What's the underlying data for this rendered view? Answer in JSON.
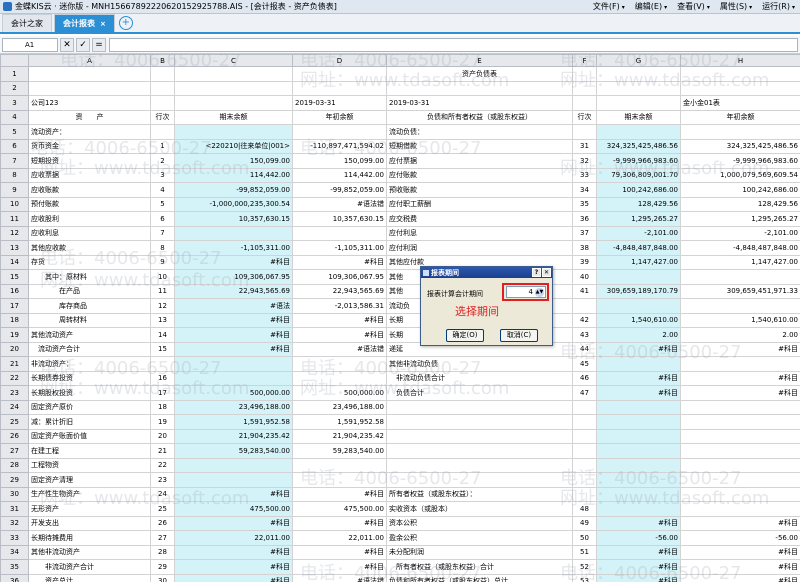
{
  "window": {
    "title": "金蝶KIS云 · 迷你版 - MNH15667892220620152925788.AIS - [会计报表 - 资产负债表]",
    "menus": [
      "文件(F)",
      "编辑(E)",
      "查看(V)",
      "属性(S)",
      "运行(R)"
    ]
  },
  "tabs": [
    {
      "label": "会计之家"
    },
    {
      "label": "会计报表",
      "close": "×"
    }
  ],
  "tab_add": "+",
  "formula": {
    "cell_ref": "A1",
    "cancel": "✕",
    "confirm": "✓",
    "fx": "="
  },
  "watermarks": [
    "电话：4006-6500-27",
    "网址：www.tdasoft.com"
  ],
  "columns": [
    "A",
    "B",
    "C",
    "D",
    "E",
    "F",
    "G",
    "H"
  ],
  "rows": [
    {
      "n": "1",
      "a": "",
      "b": "",
      "c": "",
      "d": "",
      "e": "资产负债表",
      "f": "",
      "g": "",
      "h": ""
    },
    {
      "n": "2",
      "a": "",
      "b": "",
      "c": "",
      "d": "",
      "e": "",
      "f": "",
      "g": "",
      "h": ""
    },
    {
      "n": "3",
      "a": "公司123",
      "b": "",
      "c": "",
      "d": "2019-03-31",
      "e": "2019-03-31",
      "f": "",
      "g": "",
      "h": "金小金01表"
    },
    {
      "n": "4",
      "a": "资　　产",
      "b": "行次",
      "c": "期末余额",
      "d": "年初余额",
      "e": "负债和所有者权益（或股东权益）",
      "f": "行次",
      "g": "期末余额",
      "h": "年初余额"
    },
    {
      "n": "5",
      "a": "流动资产：",
      "b": "",
      "c": "",
      "d": "",
      "e": "流动负债：",
      "f": "",
      "g": "",
      "h": ""
    },
    {
      "n": "6",
      "a": "货币资金",
      "b": "1",
      "c": "<220210|往来单位|001>",
      "d": "-110,897,471,594.02",
      "e": "短期借款",
      "f": "31",
      "g": "324,325,425,486.56",
      "h": "324,325,425,486.56"
    },
    {
      "n": "7",
      "a": "短期投资",
      "b": "2",
      "c": "150,099.00",
      "d": "150,099.00",
      "e": "应付票据",
      "f": "32",
      "g": "-9,999,966,983.60",
      "h": "-9,999,966,983.60"
    },
    {
      "n": "8",
      "a": "应收票据",
      "b": "3",
      "c": "114,442.00",
      "d": "114,442.00",
      "e": "应付账款",
      "f": "33",
      "g": "79,306,809,001.70",
      "h": "1,000,079,569,609.54"
    },
    {
      "n": "9",
      "a": "应收账款",
      "b": "4",
      "c": "-99,852,059.00",
      "d": "-99,852,059.00",
      "e": "预收账款",
      "f": "34",
      "g": "100,242,686.00",
      "h": "100,242,686.00"
    },
    {
      "n": "10",
      "a": "预付账款",
      "b": "5",
      "c": "-1,000,000,235,300.54",
      "d": "#语法错",
      "e": "应付职工薪酬",
      "f": "35",
      "g": "128,429.56",
      "h": "128,429.56"
    },
    {
      "n": "11",
      "a": "应收股利",
      "b": "6",
      "c": "10,357,630.15",
      "d": "10,357,630.15",
      "e": "应交税费",
      "f": "36",
      "g": "1,295,265.27",
      "h": "1,295,265.27"
    },
    {
      "n": "12",
      "a": "应收利息",
      "b": "7",
      "c": "",
      "d": "",
      "e": "应付利息",
      "f": "37",
      "g": "-2,101.00",
      "h": "-2,101.00"
    },
    {
      "n": "13",
      "a": "其他应收款",
      "b": "8",
      "c": "-1,105,311.00",
      "d": "-1,105,311.00",
      "e": "应付利润",
      "f": "38",
      "g": "-4,848,487,848.00",
      "h": "-4,848,487,848.00"
    },
    {
      "n": "14",
      "a": "存货",
      "b": "9",
      "c": "#科目",
      "d": "#科目",
      "e": "其他应付款",
      "f": "39",
      "g": "1,147,427.00",
      "h": "1,147,427.00"
    },
    {
      "n": "15",
      "a": "　　其中：原材料",
      "b": "10",
      "c": "109,306,067.95",
      "d": "109,306,067.95",
      "e": "其他",
      "f": "40",
      "g": "",
      "h": ""
    },
    {
      "n": "16",
      "a": "　　　　在产品",
      "b": "11",
      "c": "22,943,565.69",
      "d": "22,943,565.69",
      "e": "其他",
      "f": "41",
      "g": "309,659,189,170.79",
      "h": "309,659,451,971.33"
    },
    {
      "n": "17",
      "a": "　　　　库存商品",
      "b": "12",
      "c": "#语法",
      "d": "-2,013,586.31",
      "e": "流动负",
      "f": "",
      "g": "",
      "h": ""
    },
    {
      "n": "18",
      "a": "　　　　周转材料",
      "b": "13",
      "c": "#科目",
      "d": "#科目",
      "e": "长期",
      "f": "42",
      "g": "1,540,610.00",
      "h": "1,540,610.00"
    },
    {
      "n": "19",
      "a": "其他流动资产",
      "b": "14",
      "c": "#科目",
      "d": "#科目",
      "e": "长期",
      "f": "43",
      "g": "2.00",
      "h": "2.00"
    },
    {
      "n": "20",
      "a": "　流动资产合计",
      "b": "15",
      "c": "#科目",
      "d": "#语法错",
      "e": "递延",
      "f": "44",
      "g": "#科目",
      "h": "#科目"
    },
    {
      "n": "21",
      "a": "非流动资产：",
      "b": "",
      "c": "",
      "d": "",
      "e": "其他非流动负债",
      "f": "45",
      "g": "",
      "h": ""
    },
    {
      "n": "22",
      "a": "长期债券投资",
      "b": "16",
      "c": "",
      "d": "",
      "e": "　非流动负债合计",
      "f": "46",
      "g": "#科目",
      "h": "#科目"
    },
    {
      "n": "23",
      "a": "长期股权投资",
      "b": "17",
      "c": "500,000.00",
      "d": "500,000.00",
      "e": "　负债合计",
      "f": "47",
      "g": "#科目",
      "h": "#科目"
    },
    {
      "n": "24",
      "a": "固定资产原价",
      "b": "18",
      "c": "23,496,188.00",
      "d": "23,496,188.00",
      "e": "",
      "f": "",
      "g": "",
      "h": ""
    },
    {
      "n": "25",
      "a": "减：累计折旧",
      "b": "19",
      "c": "1,591,952.58",
      "d": "1,591,952.58",
      "e": "",
      "f": "",
      "g": "",
      "h": ""
    },
    {
      "n": "26",
      "a": "固定资产账面价值",
      "b": "20",
      "c": "21,904,235.42",
      "d": "21,904,235.42",
      "e": "",
      "f": "",
      "g": "",
      "h": ""
    },
    {
      "n": "27",
      "a": "在建工程",
      "b": "21",
      "c": "59,283,540.00",
      "d": "59,283,540.00",
      "e": "",
      "f": "",
      "g": "",
      "h": ""
    },
    {
      "n": "28",
      "a": "工程物资",
      "b": "22",
      "c": "",
      "d": "",
      "e": "",
      "f": "",
      "g": "",
      "h": ""
    },
    {
      "n": "29",
      "a": "固定资产清理",
      "b": "23",
      "c": "",
      "d": "",
      "e": "",
      "f": "",
      "g": "",
      "h": ""
    },
    {
      "n": "30",
      "a": "生产性生物资产",
      "b": "24",
      "c": "#科目",
      "d": "#科目",
      "e": "所有者权益（或股东权益）：",
      "f": "",
      "g": "",
      "h": ""
    },
    {
      "n": "31",
      "a": "无形资产",
      "b": "25",
      "c": "475,500.00",
      "d": "475,500.00",
      "e": "实收资本（或股本）",
      "f": "48",
      "g": "",
      "h": ""
    },
    {
      "n": "32",
      "a": "开发支出",
      "b": "26",
      "c": "#科目",
      "d": "#科目",
      "e": "资本公积",
      "f": "49",
      "g": "#科目",
      "h": "#科目"
    },
    {
      "n": "33",
      "a": "长期待摊费用",
      "b": "27",
      "c": "22,011.00",
      "d": "22,011.00",
      "e": "盈余公积",
      "f": "50",
      "g": "-56.00",
      "h": "-56.00"
    },
    {
      "n": "34",
      "a": "其他非流动资产",
      "b": "28",
      "c": "#科目",
      "d": "#科目",
      "e": "未分配利润",
      "f": "51",
      "g": "#科目",
      "h": "#科目"
    },
    {
      "n": "35",
      "a": "　　非流动资产合计",
      "b": "29",
      "c": "#科目",
      "d": "#科目",
      "e": "　所有者权益（或股东权益）合计",
      "f": "52",
      "g": "#科目",
      "h": "#科目"
    },
    {
      "n": "36",
      "a": "　　资产总计",
      "b": "30",
      "c": "#科目",
      "d": "#语法错",
      "e": "负债和所有者权益（或股东权益）总计",
      "f": "53",
      "g": "#科目",
      "h": "#科目"
    }
  ],
  "dialog": {
    "title": "报表期间",
    "help": "?",
    "close": "✕",
    "label": "报表计算会计期间",
    "period_value": "4",
    "spin": "▲▼",
    "annotation": "选择期间",
    "ok": "确定(O)",
    "cancel": "取消(C)"
  }
}
